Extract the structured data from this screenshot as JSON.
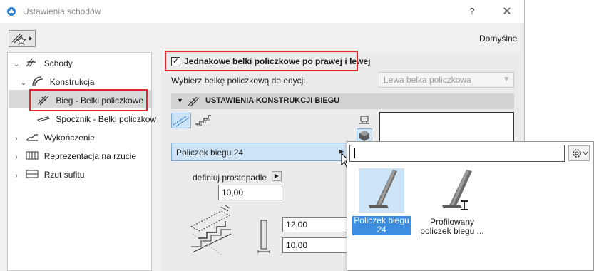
{
  "window": {
    "title": "Ustawienia schodów",
    "help": "?",
    "close": "✕"
  },
  "toolbar": {
    "defaults_label": "Domyślne"
  },
  "tree": {
    "items": [
      {
        "label": "Schody",
        "chevron": "⌄"
      },
      {
        "label": "Konstrukcja",
        "chevron": "⌄"
      },
      {
        "label": "Bieg - Belki policzkowe",
        "chevron": ""
      },
      {
        "label": "Spocznik - Belki policzkow",
        "chevron": ""
      },
      {
        "label": "Wykończenie",
        "chevron": "›"
      },
      {
        "label": "Reprezentacja na rzucie",
        "chevron": "›"
      },
      {
        "label": "Rzut sufitu",
        "chevron": "›"
      }
    ]
  },
  "main": {
    "checkbox_label": "Jednakowe belki policzkowe po prawej i lewej",
    "checkbox_mark": "✓",
    "select_label": "Wybierz belkę policzkową do edycji",
    "select_value": "Lewa belka policzkowa",
    "section_title": "USTAWIENIA KONSTRUKCJI BIEGU",
    "picker_value": "Policzek biegu 24",
    "define_label": "definiuj prostopadle",
    "field_top": "10,00",
    "field_mid": "12,00",
    "field_bot": "10,00"
  },
  "popup": {
    "search_value": "",
    "items": [
      {
        "label": "Policzek biegu 24"
      },
      {
        "label": "Profilowany policzek biegu ..."
      }
    ]
  },
  "colors": {
    "highlight_red": "#e0282f",
    "selection_blue": "#3d8ee0",
    "selection_light": "#cde4f7"
  }
}
